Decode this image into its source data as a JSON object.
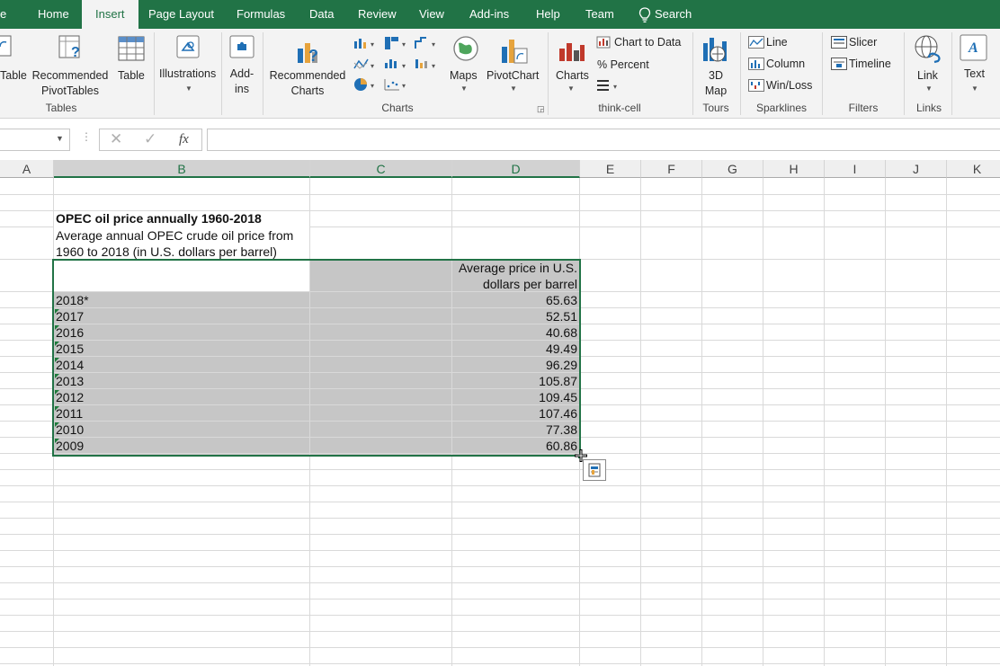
{
  "tabs": [
    "e",
    "Home",
    "Insert",
    "Page Layout",
    "Formulas",
    "Data",
    "Review",
    "View",
    "Add-ins",
    "Help",
    "Team",
    "Search"
  ],
  "ribbon": {
    "table_cut": "Table",
    "recommended_pivot": "Recommended\nPivotTables",
    "table": "Table",
    "illustrations": "Illustrations",
    "addins": "Add-\nins",
    "recommended_charts": "Recommended\nCharts",
    "maps": "Maps",
    "pivotchart": "PivotChart",
    "charts_tc": "Charts",
    "chart_to_data": "Chart to Data",
    "percent": "% Percent",
    "map3d": "3D\nMap",
    "line": "Line",
    "column": "Column",
    "winloss": "Win/Loss",
    "slicer": "Slicer",
    "timeline": "Timeline",
    "link": "Link",
    "text": "Text",
    "groups": {
      "tables": "Tables",
      "charts": "Charts",
      "thinkcell": "think-cell",
      "tours": "Tours",
      "sparklines": "Sparklines",
      "filters": "Filters",
      "links": "Links"
    }
  },
  "formula_bar": {
    "fx": "fx",
    "value": ""
  },
  "columns": [
    "A",
    "B",
    "C",
    "D",
    "E",
    "F",
    "G",
    "H",
    "I",
    "J",
    "K"
  ],
  "sheet": {
    "title": "OPEC oil price annually 1960-2018",
    "subtitle_line1": "Average annual OPEC crude oil price from",
    "subtitle_line2": "1960 to 2018 (in U.S. dollars per barrel)",
    "header_line1": "Average price in U.S.",
    "header_line2": "dollars per barrel",
    "rows": [
      {
        "year": "2018*",
        "price": "65.63"
      },
      {
        "year": "2017",
        "price": "52.51"
      },
      {
        "year": "2016",
        "price": "40.68"
      },
      {
        "year": "2015",
        "price": "49.49"
      },
      {
        "year": "2014",
        "price": "96.29"
      },
      {
        "year": "2013",
        "price": "105.87"
      },
      {
        "year": "2012",
        "price": "109.45"
      },
      {
        "year": "2011",
        "price": "107.46"
      },
      {
        "year": "2010",
        "price": "77.38"
      },
      {
        "year": "2009",
        "price": "60.86"
      }
    ]
  },
  "colors": {
    "accent": "#217346",
    "selection_fill": "#c6c6c6"
  }
}
